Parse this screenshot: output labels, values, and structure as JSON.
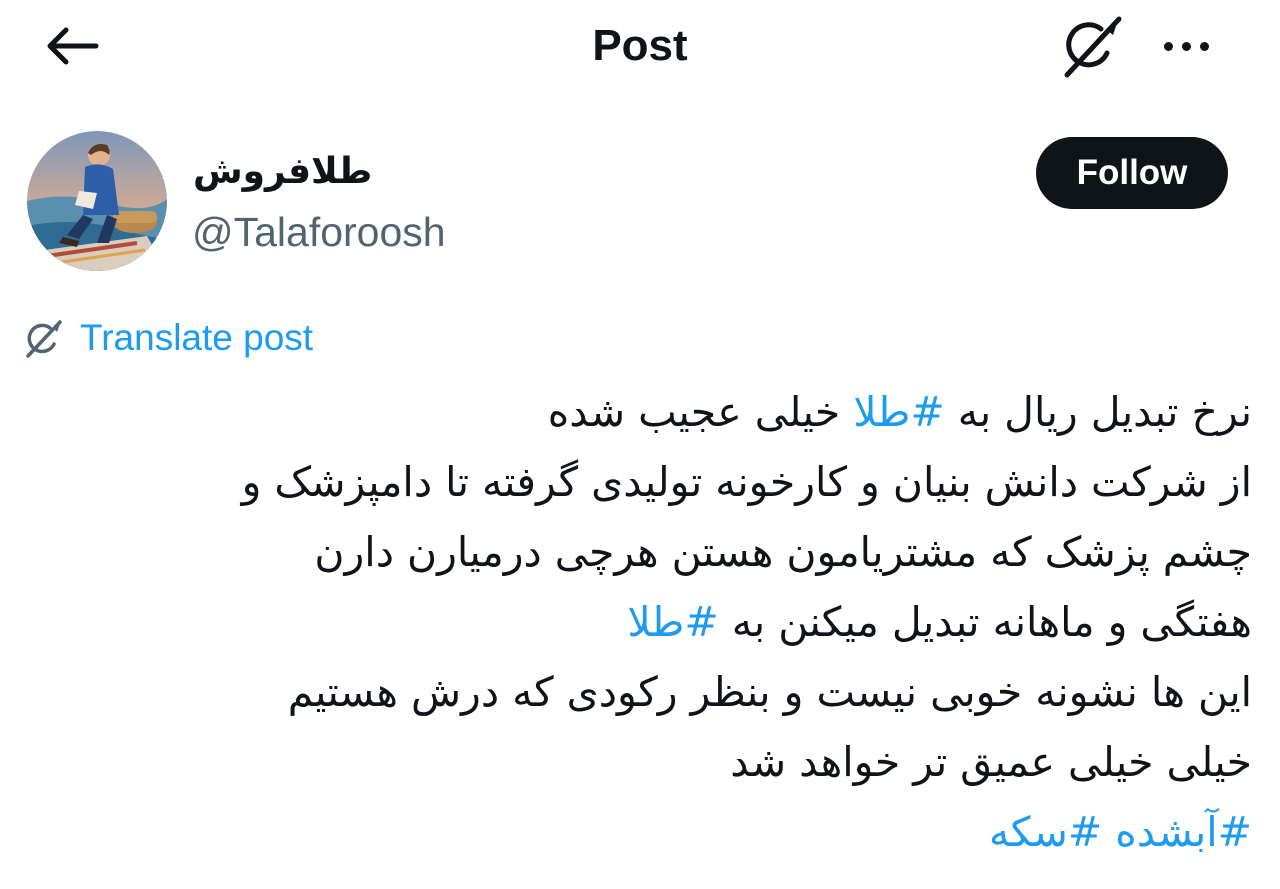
{
  "header": {
    "title": "Post",
    "back_icon": "arrow-left-icon",
    "grok_icon": "grok-icon",
    "more_icon": "more-horizontal-icon"
  },
  "author": {
    "display_name": "طلافروش",
    "handle": "@Talaforoosh",
    "avatar": "avatar-image"
  },
  "follow_label": "Follow",
  "translate": {
    "label": "Translate post",
    "icon": "translate-icon"
  },
  "post": {
    "line1": {
      "text1": "نرخ تبدیل ریال به ",
      "tag": "#طلا",
      "text2": " خیلی عجیب شده"
    },
    "line2": "از شرکت دانش بنیان و کارخونه تولیدی گرفته تا دامپزشک و",
    "line3": "چشم پزشک که مشتریامون هستن هرچی درمیارن دارن",
    "line4": {
      "text": "هفتگی و ماهانه تبدیل میکنن به ",
      "tag": "#طلا"
    },
    "line5": "این ها نشونه خوبی نیست و بنظر رکودی که درش هستیم",
    "line6": "خیلی خیلی عمیق تر خواهد شد",
    "line7": {
      "tag1": "#آبشده",
      "tag2": "#سکه"
    }
  },
  "colors": {
    "link": "#1d9bf0",
    "text": "#0f1419",
    "secondary": "#536471",
    "button": "#0f1419"
  }
}
